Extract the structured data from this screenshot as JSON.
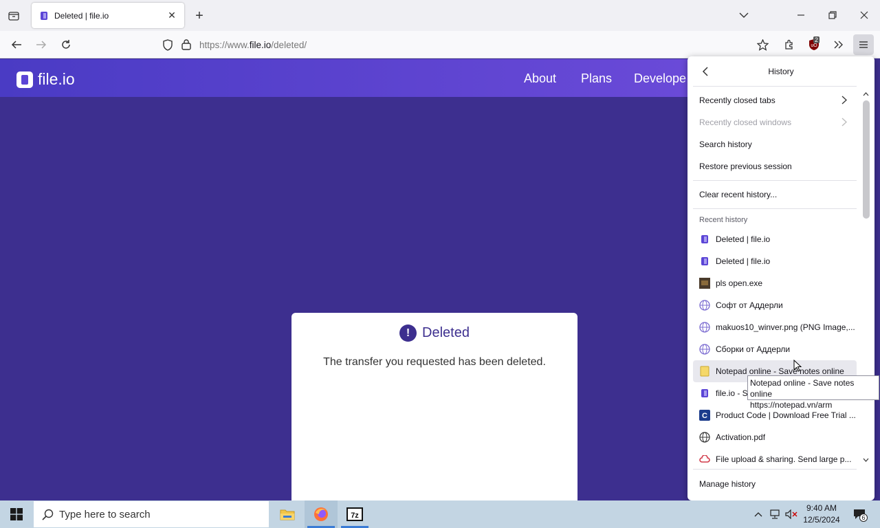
{
  "browser": {
    "tab": {
      "title": "Deleted | file.io"
    },
    "url": {
      "prefix": "https://www.",
      "domain": "file.io",
      "path": "/deleted/"
    },
    "extension_badge": "2"
  },
  "site": {
    "logo_text": "file.io",
    "nav": [
      "About",
      "Plans",
      "Develope"
    ]
  },
  "card": {
    "icon": "!",
    "title": "Deleted",
    "message": "The transfer you requested has been deleted."
  },
  "history_panel": {
    "title": "History",
    "menu": [
      {
        "label": "Recently closed tabs",
        "disabled": false,
        "chevron": true
      },
      {
        "label": "Recently closed windows",
        "disabled": true,
        "chevron": true
      },
      {
        "label": "Search history",
        "disabled": false,
        "chevron": false
      },
      {
        "label": "Restore previous session",
        "disabled": false,
        "chevron": false
      }
    ],
    "clear": "Clear recent history...",
    "recent_label": "Recent history",
    "items": [
      {
        "label": "Deleted | file.io",
        "icon": "fileio-icon"
      },
      {
        "label": "Deleted | file.io",
        "icon": "fileio-icon"
      },
      {
        "label": "pls open.exe",
        "icon": "image-thumb-icon"
      },
      {
        "label": "Софт от Аддерли",
        "icon": "web-icon"
      },
      {
        "label": "makuos10_winver.png (PNG Image,...",
        "icon": "web-icon"
      },
      {
        "label": "Сборки от Аддерли",
        "icon": "web-icon"
      },
      {
        "label": "Notepad online - Save notes online",
        "icon": "notepad-icon"
      },
      {
        "label": "file.io - S",
        "icon": "fileio-icon"
      },
      {
        "label": "Product Code | Download Free Trial ...",
        "icon": "product-icon"
      },
      {
        "label": "Activation.pdf",
        "icon": "globe-icon"
      },
      {
        "label": "File upload & sharing. Send large p...",
        "icon": "cloud-icon"
      }
    ],
    "manage": "Manage history"
  },
  "tooltip": {
    "line1": "Notepad online - Save notes online",
    "line2": "https://notepad.vn/arm"
  },
  "taskbar": {
    "search_placeholder": "Type here to search",
    "time": "9:40 AM",
    "date": "12/5/2024",
    "notification_count": "6"
  }
}
